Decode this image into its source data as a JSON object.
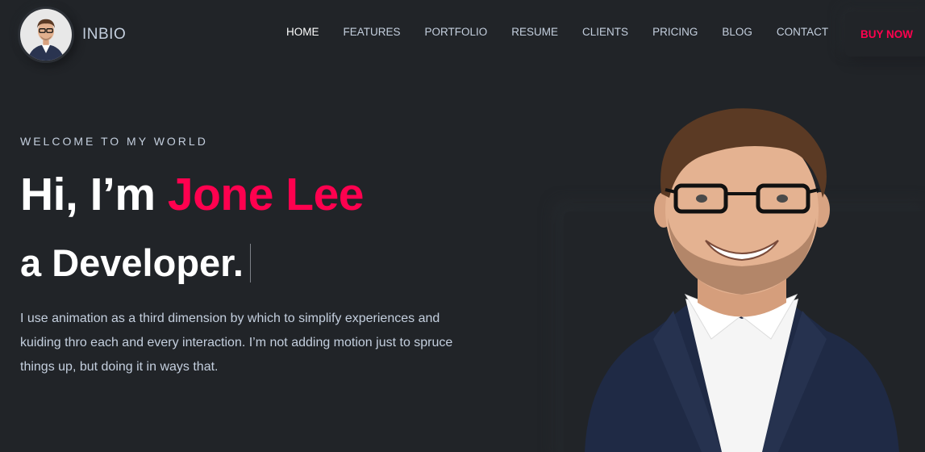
{
  "header": {
    "brand": "INBIO",
    "nav": [
      {
        "label": "HOME",
        "active": true
      },
      {
        "label": "FEATURES",
        "active": false
      },
      {
        "label": "PORTFOLIO",
        "active": false
      },
      {
        "label": "RESUME",
        "active": false
      },
      {
        "label": "CLIENTS",
        "active": false
      },
      {
        "label": "PRICING",
        "active": false
      },
      {
        "label": "BLOG",
        "active": false
      },
      {
        "label": "CONTACT",
        "active": false
      }
    ],
    "buy_label": "BUY NOW"
  },
  "hero": {
    "kicker": "WELCOME TO MY WORLD",
    "greeting": "Hi, I’m ",
    "name": "Jone Lee",
    "subtitle": "a Developer.",
    "description": "I use animation as a third dimension by which to simplify experiences and kuiding thro each and every interaction. I’m not adding motion just to spruce things up, but doing it in ways that."
  },
  "colors": {
    "background": "#212428",
    "accent": "#ff014f",
    "text": "#c4cfde",
    "heading": "#ffffff"
  },
  "icons": {
    "avatar": "person-photo",
    "portrait": "person-photo"
  }
}
